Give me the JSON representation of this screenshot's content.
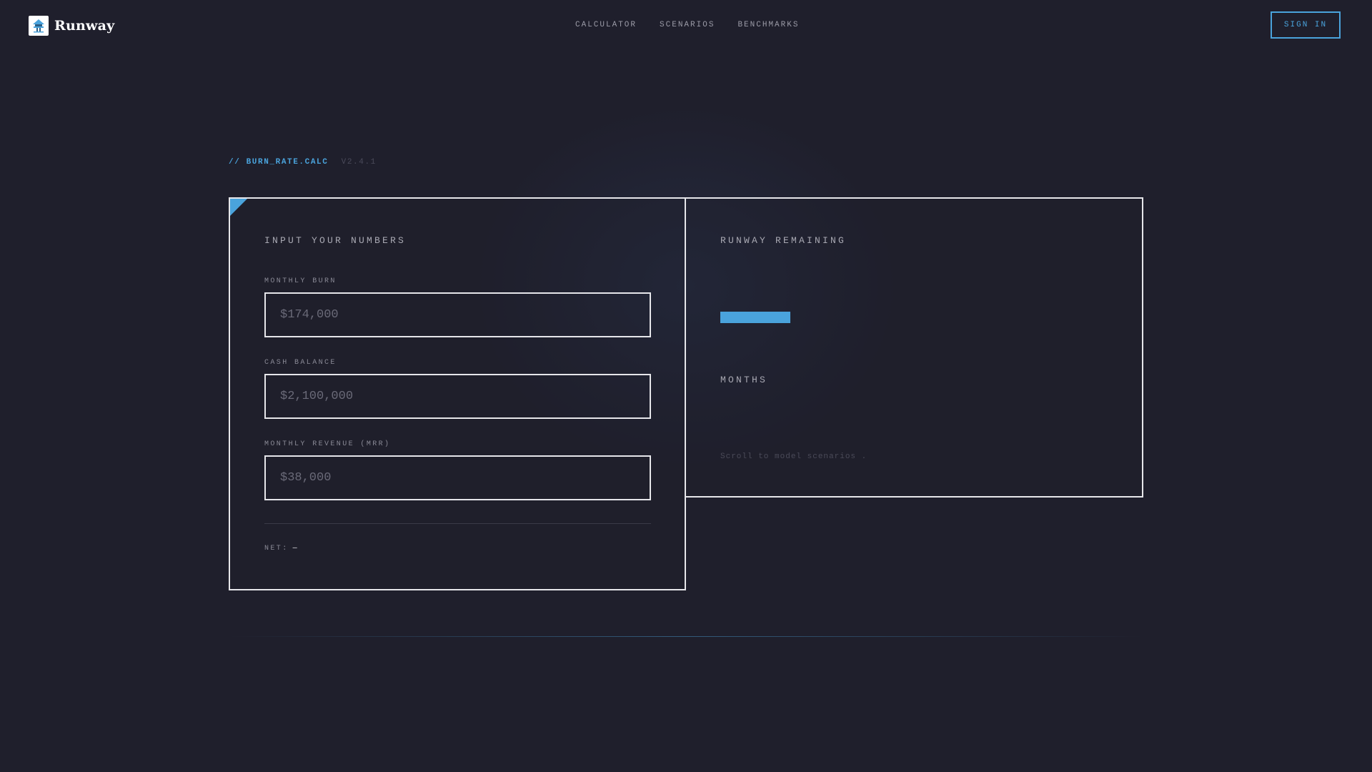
{
  "header": {
    "brand": "Runway",
    "nav": [
      "CALCULATOR",
      "SCENARIOS",
      "BENCHMARKS"
    ],
    "signin_label": "SIGN IN"
  },
  "section": {
    "prefix": "//",
    "filename": "BURN_RATE.CALC",
    "version": "V2.4.1"
  },
  "inputs_panel": {
    "heading": "INPUT YOUR NUMBERS",
    "fields": [
      {
        "label": "MONTHLY BURN",
        "placeholder": "$174,000",
        "value": ""
      },
      {
        "label": "CASH BALANCE",
        "placeholder": "$2,100,000",
        "value": ""
      },
      {
        "label": "MONTHLY REVENUE (MRR)",
        "placeholder": "$38,000",
        "value": ""
      }
    ],
    "net_label": "NET:",
    "net_value": "—"
  },
  "result_panel": {
    "heading": "RUNWAY REMAINING",
    "unit": "MONTHS",
    "hint": "Scroll to model scenarios ."
  },
  "colors": {
    "background": "#1f1f2c",
    "accent": "#4aa3dc",
    "border": "#e6e6ea"
  },
  "icons": {
    "brand_logo": "runway-logo-icon",
    "corner": "corner-accent-icon"
  }
}
